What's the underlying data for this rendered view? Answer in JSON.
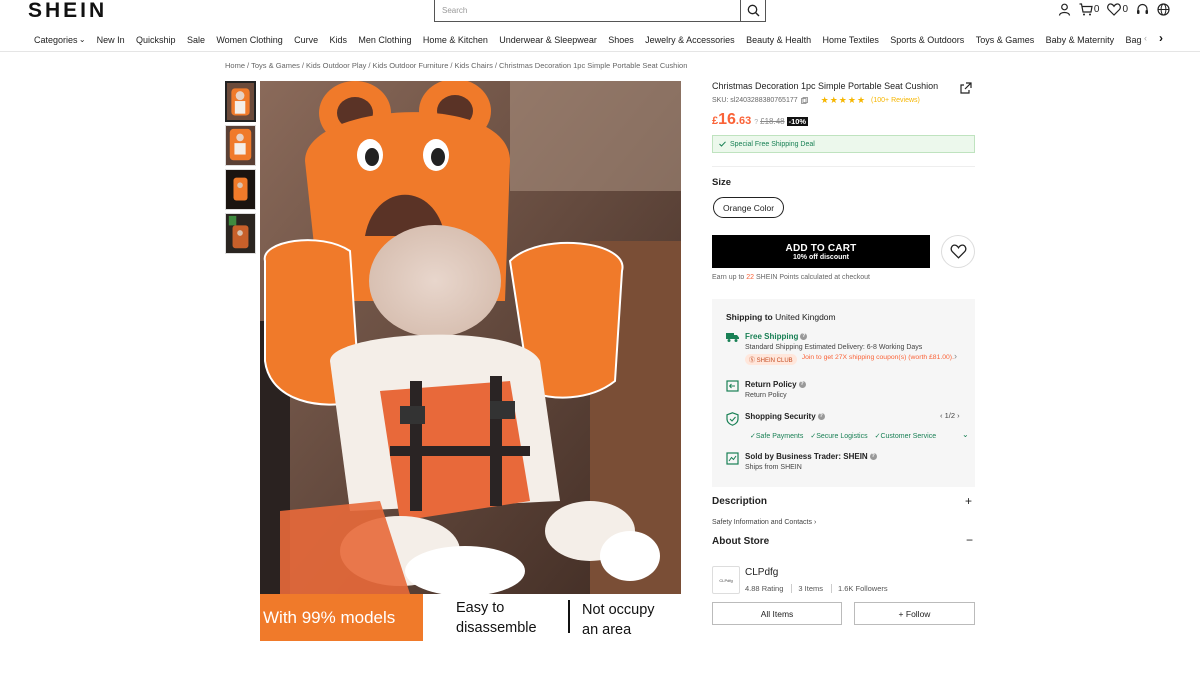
{
  "header": {
    "logo": "SHEIN",
    "search_placeholder": "Search",
    "cart_count": "0",
    "wishlist_count": "0"
  },
  "nav": {
    "items": [
      "Categories",
      "New In",
      "Quickship",
      "Sale",
      "Women Clothing",
      "Curve",
      "Kids",
      "Men Clothing",
      "Home & Kitchen",
      "Underwear & Sleepwear",
      "Shoes",
      "Jewelry & Accessories",
      "Beauty & Health",
      "Home Textiles",
      "Sports & Outdoors",
      "Toys & Games",
      "Baby & Maternity",
      "Bags & Luggag"
    ],
    "overflow": "‹"
  },
  "breadcrumb": [
    "Home",
    "Toys & Games",
    "Kids Outdoor Play",
    "Kids Outdoor Furniture",
    "Kids Chairs",
    "Christmas Decoration 1pc Simple Portable Seat Cushion"
  ],
  "image_banner": {
    "a": "With 99% models",
    "b1": "Easy to",
    "b2": "disassemble",
    "c1": "Not occupy",
    "c2": "an area"
  },
  "product": {
    "title": "Christmas Decoration 1pc Simple Portable Seat Cushion",
    "sku": "SKU: sl2403288380765177",
    "rating_stars": 4.5,
    "reviews": "(100+ Reviews)",
    "price_currency": "£",
    "price_int": "16",
    "price_dec": ".63",
    "price_old": "£18.48",
    "discount": "-10%",
    "shipping_deal": "Special Free Shipping Deal",
    "size_label": "Size",
    "size_option": "Orange Color",
    "cart_main": "ADD TO CART",
    "cart_sub": "10% off discount",
    "points_pre": "Earn up to ",
    "points_val": "22",
    "points_post": " SHEIN Points calculated at checkout"
  },
  "shipping": {
    "head_label": "Shipping to",
    "head_country": "United Kingdom",
    "free_title": "Free Shipping",
    "free_desc": "Standard Shipping Estimated Delivery: 6-8 Working Days",
    "club_badge": "SHEIN CLUB",
    "club_text": "Join to get 27X shipping coupon(s) (worth £81.00).",
    "return_title": "Return Policy",
    "return_desc": "Return Policy",
    "security_title": "Shopping Security",
    "security_page": "1/2",
    "security_items": [
      "Safe Payments",
      "Secure Logistics",
      "Customer Service"
    ],
    "seller_title": "Sold by Business Trader: SHEIN",
    "seller_desc": "Ships from SHEIN"
  },
  "sections": {
    "description": "Description",
    "safety": "Safety Information and Contacts",
    "about": "About Store"
  },
  "store": {
    "logo_text": "CLPdfg",
    "name": "CLPdfg",
    "rating": "4.88",
    "rating_label": "Rating",
    "items": "3",
    "items_label": "Items",
    "followers": "1.6K",
    "followers_label": "Followers",
    "all_items": "All Items",
    "follow": "+ Follow"
  },
  "colors": {
    "accent": "#fa6338",
    "green": "#198055",
    "seat_orange": "#f07a2a"
  }
}
